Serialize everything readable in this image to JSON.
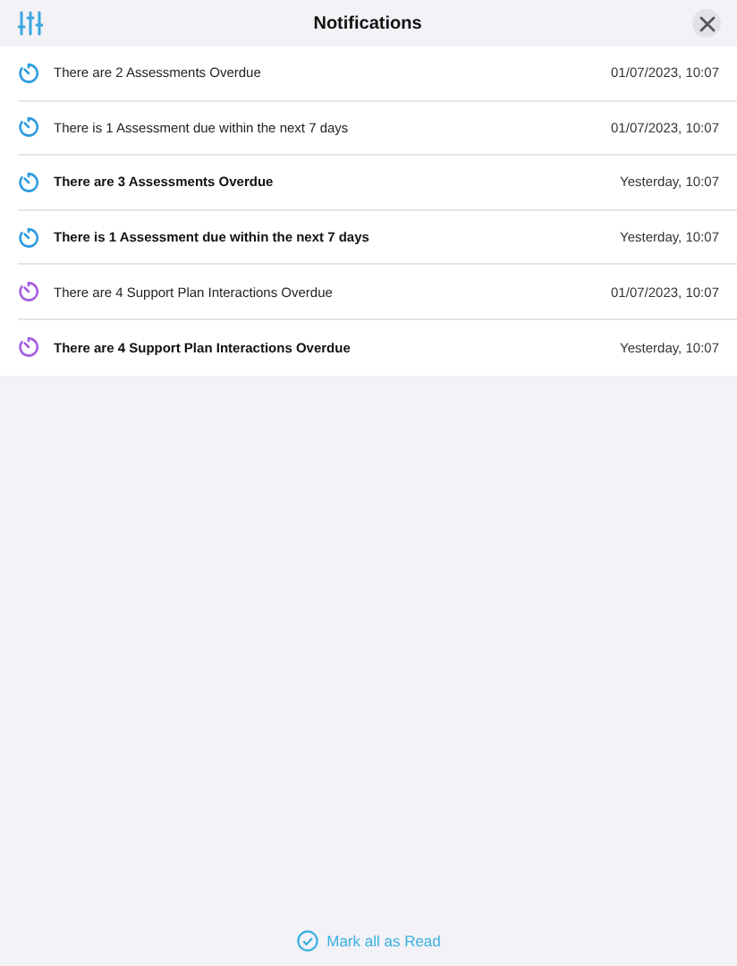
{
  "header": {
    "title": "Notifications"
  },
  "notifications": [
    {
      "text": "There are 2 Assessments Overdue",
      "time": "01/07/2023, 10:07",
      "unread": false,
      "color": "#2d9be0"
    },
    {
      "text": "There is 1 Assessment due within the next 7 days",
      "time": "01/07/2023, 10:07",
      "unread": false,
      "color": "#2d9be0"
    },
    {
      "text": "There are 3 Assessments Overdue",
      "time": "Yesterday, 10:07",
      "unread": true,
      "color": "#2d9be0"
    },
    {
      "text": "There is 1 Assessment due within the next 7 days",
      "time": "Yesterday, 10:07",
      "unread": true,
      "color": "#2d9be0"
    },
    {
      "text": "There are 4 Support Plan Interactions Overdue",
      "time": "01/07/2023, 10:07",
      "unread": false,
      "color": "#a65de0"
    },
    {
      "text": "There are 4 Support Plan Interactions Overdue",
      "time": "Yesterday, 10:07",
      "unread": true,
      "color": "#a65de0"
    }
  ],
  "footer": {
    "action": "Mark all as Read"
  }
}
